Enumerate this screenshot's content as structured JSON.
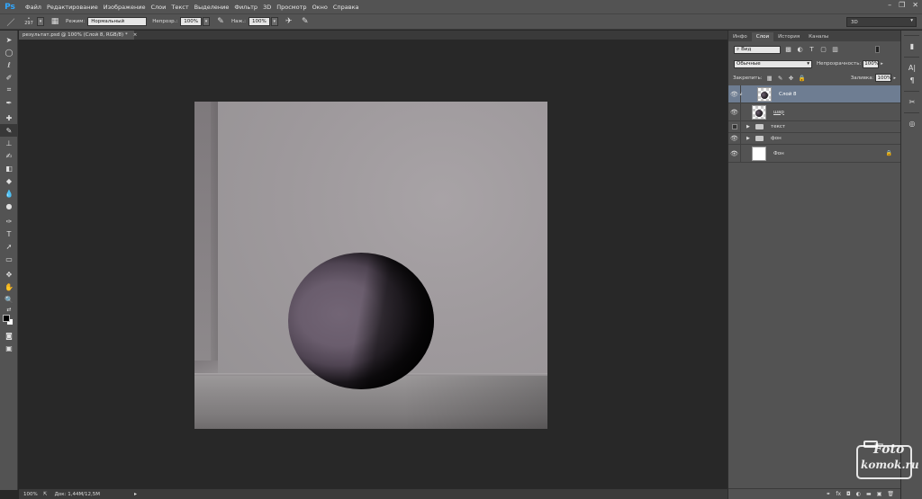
{
  "app": {
    "logo": "Ps"
  },
  "menu": [
    "Файл",
    "Редактирование",
    "Изображение",
    "Слои",
    "Текст",
    "Выделение",
    "Фильтр",
    "3D",
    "Просмотр",
    "Окно",
    "Справка"
  ],
  "options": {
    "brush_size": "297",
    "mode_label": "Режим:",
    "mode_value": "Нормальный",
    "opacity_label": "Непрозр.:",
    "opacity_value": "100%",
    "pressure_label": "Наж.:",
    "pressure_value": "100%",
    "workspace": "3D"
  },
  "document": {
    "tab_title": "результат.psd @ 100% (Слой 8, RGB/8) *",
    "close": "×"
  },
  "status": {
    "zoom": "100%",
    "info": "Док: 1,44M/12,5M"
  },
  "panel": {
    "tabs": [
      "Инфо",
      "Слои",
      "История",
      "Каналы"
    ],
    "active_tab": "Слои",
    "kind_filter": "Вид",
    "blend_mode": "Обычные",
    "opacity_label": "Непрозрачность:",
    "opacity_value": "100%",
    "lock_label": "Закрепить:",
    "fill_label": "Заливка:",
    "fill_value": "100%"
  },
  "layers": [
    {
      "name": "Слой 8",
      "type": "raster",
      "visible": true,
      "selected": true
    },
    {
      "name": "шар",
      "type": "raster",
      "visible": true,
      "selected": false
    },
    {
      "name": "текст",
      "type": "group",
      "visible": false,
      "selected": false
    },
    {
      "name": "фон",
      "type": "group",
      "visible": true,
      "selected": false
    },
    {
      "name": "Фон",
      "type": "background",
      "visible": true,
      "selected": false,
      "locked": true
    }
  ],
  "watermark": {
    "line1": "Foto",
    "line2": "komok.ru"
  }
}
